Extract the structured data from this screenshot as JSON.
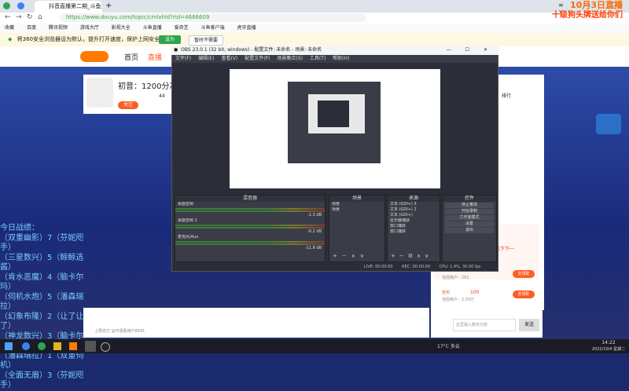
{
  "browser": {
    "tabs": [
      {
        "label": "抖音直播第二期_斗鱼主页文字...",
        "active": true
      }
    ],
    "url": "https://www.douyu.com/topic/cmlxhld?rid=4666609",
    "window_title": "10月3日直播",
    "bookmarks": [
      "收藏",
      "百度",
      "腾讯视频",
      "游戏大厅",
      "影视大全",
      "斗鱼直播",
      "爱奇艺",
      "斗鱼客户端",
      "虎牙直播"
    ],
    "infobar_text": "将360安全浏览器设为默认，提升打开速度，保护上网安全",
    "infobar_button": "设为",
    "infobar_dismiss": "暂时不需要"
  },
  "overlay_banner": {
    "line1": "10月3日直播",
    "line2": "十级狗头牌送给你们"
  },
  "page": {
    "nav": [
      "首页",
      "直播"
    ],
    "room_title": "初音：1200分冲140",
    "room_actions": [
      "分享",
      "举报",
      "关注"
    ],
    "follow_count": "44",
    "left_list_title": "今日战绩：",
    "left_list": [
      "（双重幽影）7（芬妮咫手）",
      "（三星数兴）5（鲸鲸选酱）",
      "（肯水恶魔）4（脑卡尔玛）",
      "（伺机水炮）5（潘森瑞拉）",
      "（幻象布隆）2（让了让了）",
      "（神龙数兴）3（脑卡尔玛）",
      "（潘森瑞拉）1（双重伺机）",
      "（全面无眉）3（芬妮咫手）"
    ],
    "rank_tab": "排行",
    "danmu_input_placeholder": "这里输入聊天内容",
    "danmu_send": "发送",
    "gift_hint": "上限自己 @可观看用户8501",
    "gift_counter": "100",
    "gift_tag": "签到",
    "promo_title": "让底下下一",
    "promo_buttons": [
      "去领取",
      "去领取"
    ],
    "promo_sub": [
      "当前用户：251",
      "当前用户：2.03万"
    ]
  },
  "obs": {
    "title": "OBS 23.0.1 (32 bit, windows) - 配置文件: 未命名 - 场景: 未命名",
    "menu": [
      "文件(F)",
      "编辑(E)",
      "查看(V)",
      "配置文件(P)",
      "场景集合(S)",
      "工具(T)",
      "帮助(H)"
    ],
    "docks": {
      "mixer": {
        "title": "混音器",
        "tracks": [
          {
            "name": "桌面音频",
            "db": "-1.3 dB"
          },
          {
            "name": "桌面音频 2",
            "db": "-6.2 dB"
          },
          {
            "name": "麦克风/Aux",
            "db": "-11.8 dB"
          }
        ]
      },
      "scenes": {
        "title": "场景",
        "items": [
          "场景",
          "场景"
        ]
      },
      "sources": {
        "title": "来源",
        "items": [
          "文本 (GDI+) 3",
          "文本 (GDI+) 2",
          "文本 (GDI+)",
          "显示器捕获",
          "窗口捕获",
          "窗口捕获"
        ]
      },
      "controls": {
        "title": "控件",
        "items": [
          "停止推流",
          "开始录制",
          "工作室模式",
          "设置",
          "退出"
        ]
      }
    },
    "status": {
      "live": "LIVE: 00:00:00",
      "rec": "REC: 00:00:00",
      "cpu": "CPU: 1.4%, 30.00 fps"
    }
  },
  "taskbar": {
    "weather": "17°C 多云",
    "time": "14:22",
    "date": "2022/10/4 星期二"
  },
  "colors": {
    "accent": "#ff5d23",
    "obs_bg": "#2b2e38",
    "page_bg": "#1a2a7a"
  }
}
